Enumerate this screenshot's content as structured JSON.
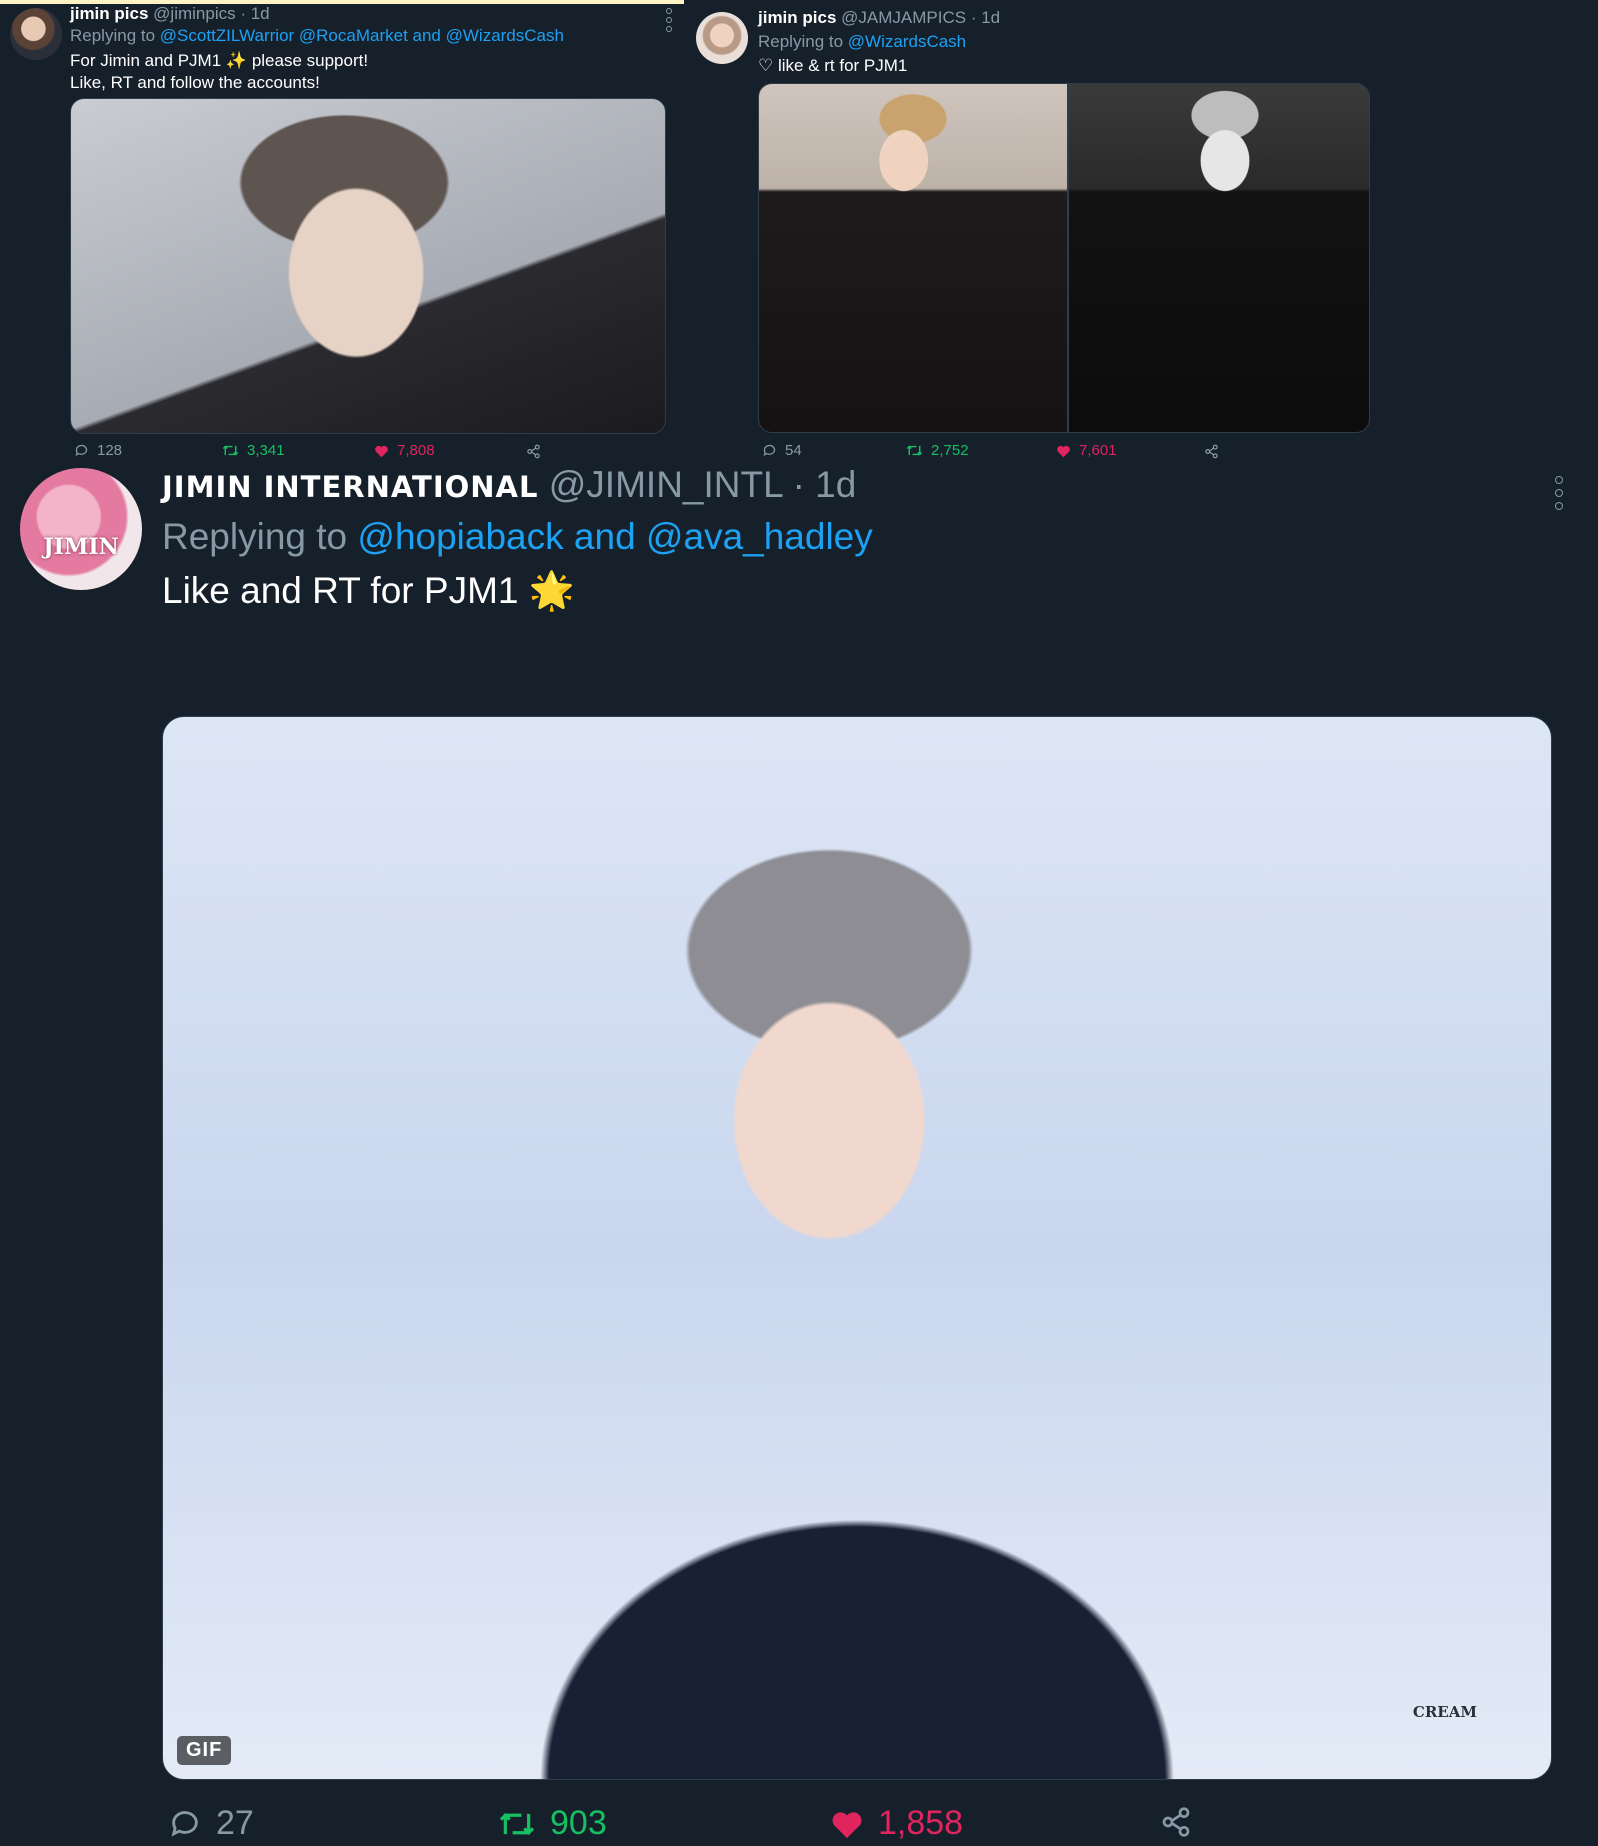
{
  "tweets": [
    {
      "name": "jimin pics",
      "handle": "@jiminpics",
      "time": "· 1d",
      "replying_prefix": "Replying to",
      "replying_to": "@ScottZILWarrior @RocaMarket and @WizardsCash",
      "text_line1_a": "For Jimin and PJM1",
      "text_line1_emoji": "✨",
      "text_line1_b": "please support!",
      "text_line2": "Like, RT and follow the accounts!",
      "replies": "128",
      "retweets": "3,341",
      "likes": "7,808"
    },
    {
      "name": "jimin pics",
      "handle": "@JAMJAMPICS",
      "time": "· 1d",
      "replying_prefix": "Replying to",
      "replying_to": "@WizardsCash",
      "text_line1": "♡ like & rt for PJM1",
      "replies": "54",
      "retweets": "2,752",
      "likes": "7,601"
    },
    {
      "name": "JIMIN INTERNATIONAL",
      "handle": "@JIMIN_INTL",
      "time": "· 1d",
      "replying_prefix": "Replying to",
      "replying_to": "@hopiaback and @ava_hadley",
      "text_line1": "Like and RT for PJM1",
      "text_emoji": "🌟",
      "avatar_text": "JIMIN",
      "gif_label": "GIF",
      "watermark": "CREAM",
      "replies": "27",
      "retweets": "903",
      "likes": "1,858"
    }
  ],
  "colors": {
    "background": "#15202b",
    "link": "#1da1f2",
    "muted": "#8899a6",
    "retweet": "#17bf63",
    "like": "#e0245e"
  },
  "icons": [
    "reply-icon",
    "retweet-icon",
    "heart-icon",
    "share-icon",
    "more-icon",
    "sparkles-icon"
  ]
}
